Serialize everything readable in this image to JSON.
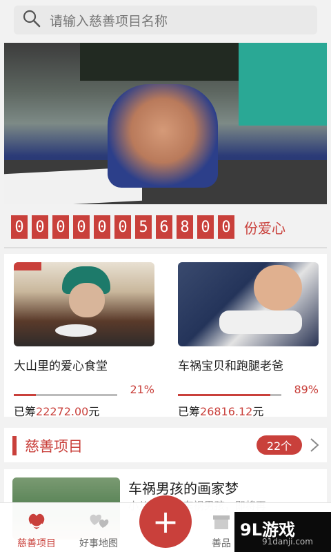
{
  "search": {
    "placeholder": "请输入慈善项目名称"
  },
  "banner": {
    "active_index": 1,
    "dots": 3
  },
  "counter": {
    "digits": [
      "0",
      "0",
      "0",
      "0",
      "0",
      "0",
      "5",
      "6",
      "8",
      "0",
      "0"
    ],
    "unit": "份爱心"
  },
  "projects": [
    {
      "title": "大山里的爱心食堂",
      "progress_pct": "21%",
      "progress_value": 0.21,
      "raised_prefix": "已筹",
      "raised_amount": "22272.00",
      "raised_suffix": "元"
    },
    {
      "title": "车祸宝贝和跑腿老爸",
      "progress_pct": "89%",
      "progress_value": 0.89,
      "raised_prefix": "已筹",
      "raised_amount": "26816.12",
      "raised_suffix": "元"
    }
  ],
  "section": {
    "title": "慈善项目",
    "count": "22个"
  },
  "list": [
    {
      "title": "车祸男孩的画家梦",
      "subtitle": "小儿…   帮的车祸男孩，即将再"
    }
  ],
  "tabs": [
    {
      "label": "慈善项目",
      "icon": "heart-hands-icon"
    },
    {
      "label": "好事地图",
      "icon": "map-icon"
    },
    {
      "label": "善品",
      "icon": "gift-icon"
    }
  ],
  "watermark": {
    "brand": "9L游戏",
    "site": "91danji.com"
  },
  "colors": {
    "accent": "#c9403b"
  }
}
